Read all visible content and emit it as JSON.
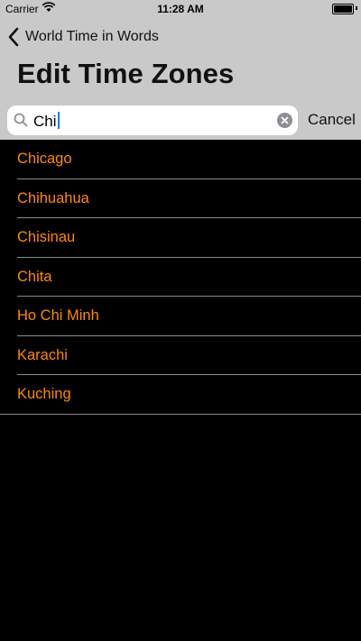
{
  "status_bar": {
    "carrier": "Carrier",
    "time": "11:28 AM",
    "battery_level": 1.0
  },
  "nav": {
    "back_label": "World Time in Words",
    "title": "Edit Time Zones"
  },
  "search": {
    "query": "Chi",
    "cancel_label": "Cancel"
  },
  "results": [
    {
      "label": "Chicago"
    },
    {
      "label": "Chihuahua"
    },
    {
      "label": "Chisinau"
    },
    {
      "label": "Chita"
    },
    {
      "label": "Ho Chi Minh"
    },
    {
      "label": "Karachi"
    },
    {
      "label": "Kuching"
    }
  ],
  "colors": {
    "accent": "#ff8a00",
    "header_bg": "#c9c9c9",
    "list_bg": "#000000"
  },
  "icons": [
    "wifi-icon",
    "battery-icon",
    "chevron-left-icon",
    "search-icon",
    "clear-icon"
  ]
}
